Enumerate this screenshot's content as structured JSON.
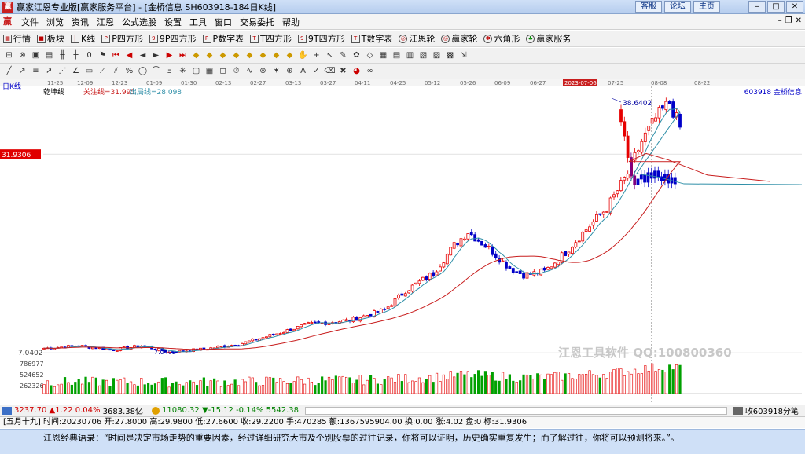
{
  "window": {
    "title": "赢家江恩专业版[赢家服务平台] - [金桥信息  SH603918-184日K线]",
    "links": [
      "客服",
      "论坛",
      "主页"
    ]
  },
  "menu": [
    "文件",
    "浏览",
    "资讯",
    "江恩",
    "公式选股",
    "设置",
    "工具",
    "窗口",
    "交易委托",
    "帮助"
  ],
  "toolbar1": [
    {
      "label": "行情",
      "icon": "grid-icon"
    },
    {
      "label": "板块",
      "icon": "blocks-icon"
    },
    {
      "label": "K线",
      "icon": "candle-icon"
    },
    {
      "label": "P四方形",
      "icon": "p-square-icon"
    },
    {
      "label": "9P四方形",
      "icon": "9p-square-icon"
    },
    {
      "label": "P数字表",
      "icon": "p-table-icon"
    },
    {
      "label": "T四方形",
      "icon": "t-square-icon"
    },
    {
      "label": "9T四方形",
      "icon": "9t-square-icon"
    },
    {
      "label": "T数字表",
      "icon": "t-table-icon"
    },
    {
      "label": "江恩轮",
      "icon": "gann-wheel-icon"
    },
    {
      "label": "赢家轮",
      "icon": "winner-wheel-icon"
    },
    {
      "label": "六角形",
      "icon": "hexagon-icon"
    },
    {
      "label": "赢家服务",
      "icon": "service-icon"
    }
  ],
  "chart": {
    "period": "日K线",
    "indicator_name": "乾坤线",
    "focus_line_label": "关注线=31.995",
    "exit_line_label": "出局线=28.098",
    "stock_label": "603918 金桥信息",
    "high_label": "38.6402",
    "low_label": "7.0402",
    "price_marker": "31.9306",
    "cursor_date": "2023-07-06",
    "watermark": "江恩工具软件 QQ:100800360",
    "volume_ticks": [
      "786977",
      "524652",
      "262326"
    ],
    "dates": [
      "11-25",
      "12-09",
      "12-23",
      "01-09",
      "01-30",
      "02-13",
      "02-27",
      "03-13",
      "03-27",
      "04-11",
      "04-25",
      "05-12",
      "05-26",
      "06-09",
      "06-27",
      "2023-07-06",
      "07-25",
      "08-08",
      "08-22"
    ],
    "colors": {
      "up": "#e60000",
      "down": "#0000c8",
      "neutral": "#800080",
      "ma_short": "#2f8fa8",
      "ma_long": "#c81e1e",
      "vol_up": "#e60000",
      "vol_down": "#00a000"
    }
  },
  "status": {
    "sh_index": "3237.70",
    "sh_change": "▲1.22",
    "sh_pct": "0.04%",
    "sh_amount": "3683.38亿",
    "sz_index": "11080.32",
    "sz_change": "▼-15.12",
    "sz_pct": "-0.14%",
    "sz_amount": "5542.38",
    "watch_label": "收603918分笔"
  },
  "info": {
    "text": "[五月十九] 时间:20230706 开:27.8000 高:29.9800 低:27.6600 收:29.2200 手:470285 额:1367595904.00 换:0.00 涨:4.02 盘:0 标:31.9306"
  },
  "quote": {
    "text": "江恩经典语录：“时间是决定市场走势的重要因素，经过详细研究大市及个别股票的过往记录，你将可以证明，历史确实重复发生；而了解过往，你将可以预测将来。”。"
  }
}
